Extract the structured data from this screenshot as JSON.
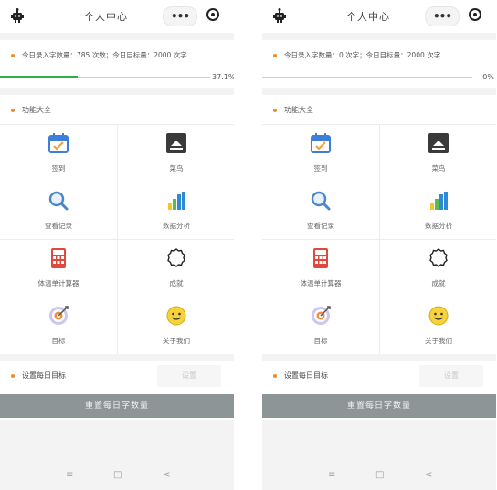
{
  "colors": {
    "accent": "#28b04a",
    "dot": "#f08c2a",
    "reset_button_bg": "#8d9596"
  },
  "phones": [
    {
      "title": "个人中心",
      "capsule": "•••",
      "stats_text": "今日录入字数量：785 次数；今日目标量：2000 次字",
      "progress_percent": 37.1,
      "progress_label": "37.1%",
      "section_title": "功能大全",
      "features": [
        {
          "label": "签到",
          "icon": "calendar-check-icon"
        },
        {
          "label": "菜鸟",
          "icon": "tray-icon"
        },
        {
          "label": "查看记录",
          "icon": "magnifier-icon"
        },
        {
          "label": "数据分析",
          "icon": "bar-chart-icon"
        },
        {
          "label": "体温单计算器",
          "icon": "calculator-icon"
        },
        {
          "label": "成就",
          "icon": "badge-icon"
        },
        {
          "label": "目标",
          "icon": "target-icon"
        },
        {
          "label": "关于我们",
          "icon": "smile-icon"
        }
      ],
      "goal_label": "设置每日目标",
      "set_button": "设置",
      "reset_button": "重置每日字数量",
      "nav": {
        "menu": "≡",
        "home": "□",
        "back": "<"
      }
    },
    {
      "title": "个人中心",
      "capsule": "•••",
      "stats_text": "今日录入字数量：0 次字；今日目标量：2000 次字",
      "progress_percent": 0,
      "progress_label": "0%",
      "section_title": "功能大全",
      "features": [
        {
          "label": "签到",
          "icon": "calendar-check-icon"
        },
        {
          "label": "菜鸟",
          "icon": "tray-icon"
        },
        {
          "label": "查看记录",
          "icon": "magnifier-icon"
        },
        {
          "label": "数据分析",
          "icon": "bar-chart-icon"
        },
        {
          "label": "体温单计算器",
          "icon": "calculator-icon"
        },
        {
          "label": "成就",
          "icon": "badge-icon"
        },
        {
          "label": "目标",
          "icon": "target-icon"
        },
        {
          "label": "关于我们",
          "icon": "smile-icon"
        }
      ],
      "goal_label": "设置每日目标",
      "set_button": "设置",
      "reset_button": "重置每日字数量",
      "nav": {
        "menu": "≡",
        "home": "□",
        "back": "<"
      }
    }
  ]
}
